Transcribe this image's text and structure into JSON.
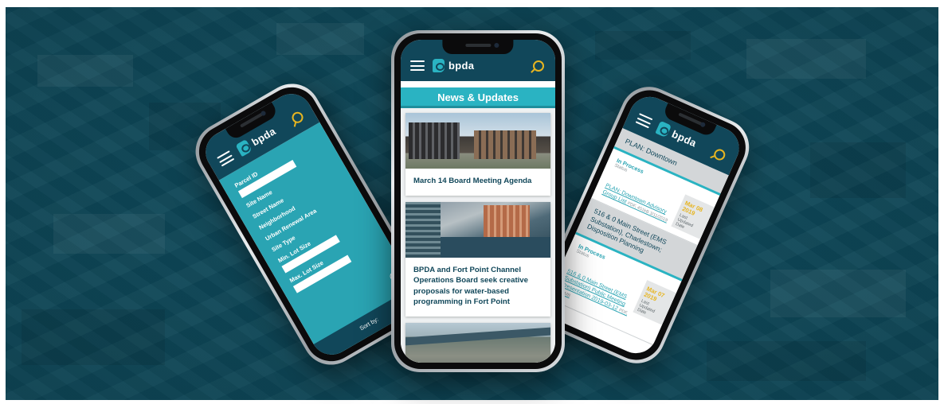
{
  "brand": {
    "logo_text": "bpda"
  },
  "center": {
    "section_title": "News & Updates",
    "cards": [
      {
        "caption": "March 14 Board Meeting Agenda"
      },
      {
        "caption": "BPDA and Fort Point Channel Operations Board seek creative proposals for water-based programming in Fort Point"
      },
      {
        "caption": ""
      }
    ]
  },
  "left": {
    "fields": [
      {
        "label": "Parcel ID",
        "kind": "input",
        "value": ""
      },
      {
        "label": "Site Name",
        "kind": "select",
        "value": ""
      },
      {
        "label": "Street Name",
        "kind": "select",
        "value": ""
      },
      {
        "label": "Neighborhood",
        "kind": "select",
        "value": ""
      },
      {
        "label": "Urban Renewal Area",
        "kind": "select",
        "value": ""
      },
      {
        "label": "Site Type",
        "kind": "select",
        "value": ""
      },
      {
        "label": "Min. Lot Size",
        "kind": "input",
        "value": ""
      },
      {
        "label": "Max. Lot Size",
        "kind": "input",
        "value": ""
      }
    ],
    "sort_label": "Sort by:",
    "sort_value": ""
  },
  "right": {
    "plan_title": "PLAN: Downtown",
    "items": [
      {
        "status": "In Process",
        "status_label": "Status",
        "date": "Mar 08 2019",
        "date_label": "Last Updated Date",
        "doc_link": "PLAN: Downtown Advisory Group List",
        "doc_meta": "PDF, 451kB 3/11/2019"
      }
    ],
    "second_title": "516 & 0 Main Street (EMS Substation), Charlestown; Disposition Planning",
    "items2": [
      {
        "status": "In Process",
        "status_label": "Status",
        "date": "Mar 07 2019",
        "date_label": "Last Updated Date",
        "doc_link": "516 & 0 Main Street (EMS Substation) Public Meeting Presentation 2019-03-12",
        "doc_meta": "PDF, 1.2MB"
      }
    ]
  },
  "colors": {
    "background": "#0f4b5c",
    "appbar": "#11475a",
    "accent_teal": "#2ab3c2",
    "accent_gold": "#e7b521"
  }
}
